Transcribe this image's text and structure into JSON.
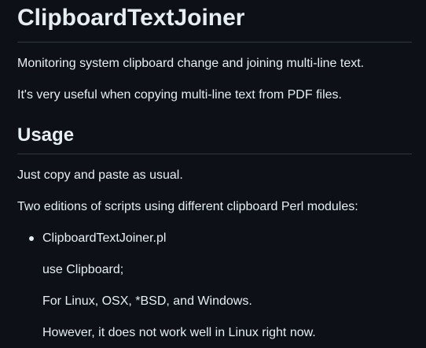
{
  "title": "ClipboardTextJoiner",
  "intro": {
    "p1": "Monitoring system clipboard change and joining multi-line text.",
    "p2": "It's very useful when copying multi-line text from PDF files."
  },
  "usage": {
    "heading": "Usage",
    "p1": "Just copy and paste as usual.",
    "p2": "Two editions of scripts using different clipboard Perl modules:",
    "list": [
      {
        "name": "ClipboardTextJoiner.pl",
        "lines": [
          "use Clipboard;",
          "For Linux, OSX, *BSD, and Windows.",
          "However, it does not work well in Linux right now."
        ]
      }
    ]
  }
}
